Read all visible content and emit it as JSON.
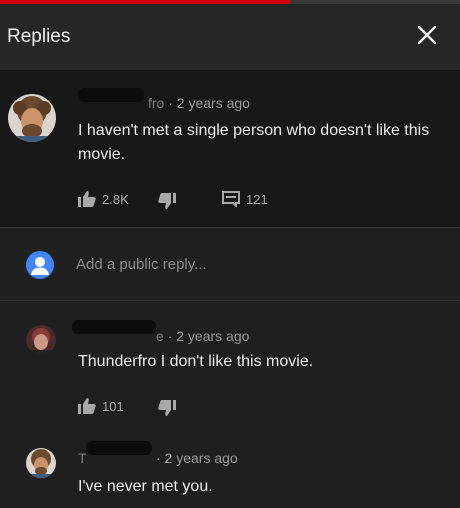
{
  "progress": {
    "played_fraction": 0.62,
    "color": "#d50000"
  },
  "header": {
    "title": "Replies",
    "close_icon": "close-icon"
  },
  "main_comment": {
    "author_partial": "fro",
    "meta": "· 2 years ago",
    "text": "I haven't met a single person who doesn't like this movie.",
    "likes": "2.8K",
    "replies_count": "121"
  },
  "reply_box": {
    "placeholder": "Add a public reply..."
  },
  "replies": [
    {
      "author_partial": "e",
      "meta": "· 2 years ago",
      "text": "Thunderfro I don't like this movie.",
      "likes": "101"
    },
    {
      "author_partial": "T",
      "meta": "· 2 years ago",
      "text": "I've never met you."
    }
  ],
  "colors": {
    "background": "#1f1f1f",
    "main_comment_bg": "#181818",
    "accent_blue": "#4285f4"
  }
}
